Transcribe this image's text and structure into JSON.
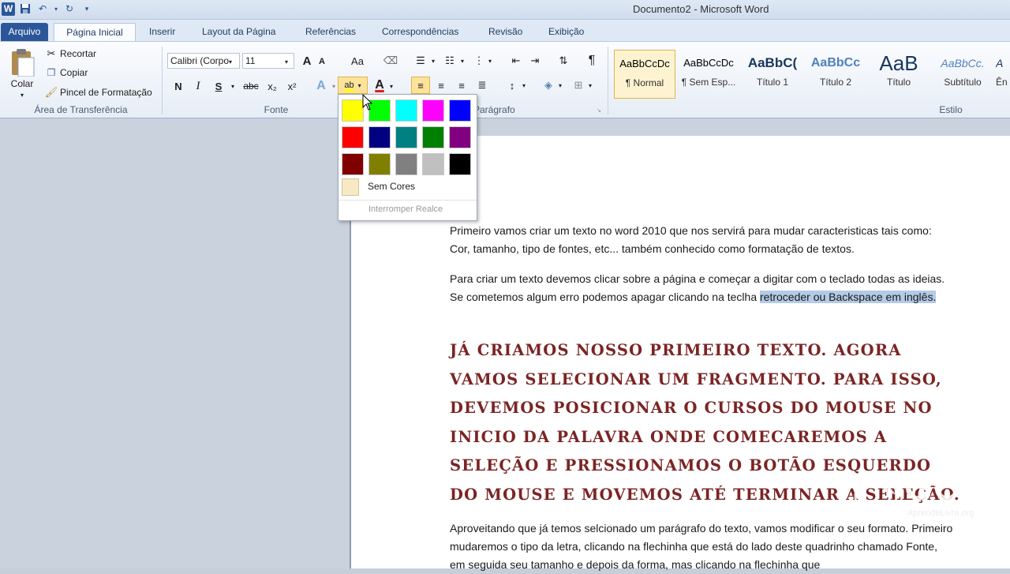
{
  "window": {
    "title": "Documento2  -  Microsoft Word"
  },
  "qat": {
    "word_logo": "W"
  },
  "tabs": [
    "Arquivo",
    "Página Inicial",
    "Inserir",
    "Layout da Página",
    "Referências",
    "Correspondências",
    "Revisão",
    "Exibição"
  ],
  "clipboard": {
    "paste": "Colar",
    "cut": "Recortar",
    "copy": "Copiar",
    "format_painter": "Pincel de Formatação",
    "label": "Área de Transferência"
  },
  "font": {
    "family": "Calibri (Corpo)",
    "size": "11",
    "bold": "N",
    "italic": "I",
    "underline": "S",
    "strike": "abc",
    "subscript": "x₂",
    "superscript": "x²",
    "grow": "A",
    "shrink": "A",
    "case": "Aa",
    "highlight": "ab",
    "font_color": "A",
    "label": "Fonte"
  },
  "paragraph": {
    "label": "Parágrafo",
    "pilcrow": "¶"
  },
  "styles": {
    "label": "Estilo",
    "items": [
      {
        "sample": "AaBbCcDc",
        "name": "¶ Normal"
      },
      {
        "sample": "AaBbCcDc",
        "name": "¶ Sem Esp..."
      },
      {
        "sample": "AaBbC(",
        "name": "Título 1"
      },
      {
        "sample": "AaBbCc",
        "name": "Título 2"
      },
      {
        "sample": "AaB",
        "name": "Título"
      },
      {
        "sample": "AaBbCc.",
        "name": "Subtítulo"
      },
      {
        "sample": "A",
        "name": "Ên"
      }
    ]
  },
  "highlight_menu": {
    "colors": [
      "#ffff00",
      "#00ff00",
      "#00ffff",
      "#ff00ff",
      "#0000ff",
      "#ff0000",
      "#000080",
      "#008080",
      "#008000",
      "#800080",
      "#800000",
      "#808000",
      "#808080",
      "#c0c0c0",
      "#000000"
    ],
    "no_color": "Sem Cores",
    "stop": "Interromper Realce"
  },
  "document": {
    "p1": "Primeiro vamos criar um texto no word 2010  que nos servirá para mudar caracteristicas tais como: Cor, tamanho, tipo de fontes, etc... também conhecido como formatação de textos.",
    "p2a": "Para criar um texto devemos clicar sobre a página e começar a digitar com o teclado todas as ideias. Se cometemos algum erro podemos apagar clicando na teclha ",
    "p2sel": "retroceder ou Backspace em inglês.",
    "big": "JÁ CRIAMOS NOSSO PRIMEIRO TEXTO. AGORA VAMOS SELECIONAR UM FRAGMENTO. PARA ISSO, DEVEMOS POSICIONAR O CURSOS DO MOUSE NO INICIO DA PALAVRA ONDE COMECAREMOS A SELEÇÃO E PRESSIONAMOS O BOTÃO ESQUERDO DO MOUSE E MOVEMOS ATÉ TERMINAR A SELEÇÃO.",
    "p3": "Aproveitando que já temos selcionado um parágrafo do texto, vamos modificar o seu formato. Primeiro mudaremos o tipo da letra, clicando na flechinha que está do lado deste quadrinho chamado Fonte, em seguida seu tamanho e depois da forma, mas clicando na flechinha que"
  },
  "watermark": {
    "brand": "GCF",
    "site": "AprendeLivre.org"
  }
}
